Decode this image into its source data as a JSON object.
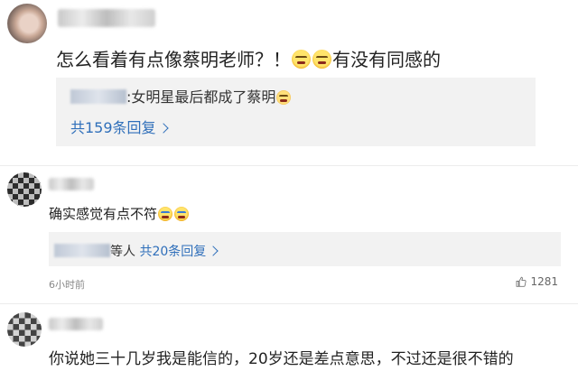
{
  "comments": [
    {
      "text_before": "怎么看着有点像蔡明老师？！",
      "text_after": "有没有同感的",
      "reply_preview_text": ":女明星最后都成了蔡明",
      "reply_count_label": "共159条回复"
    },
    {
      "text": "确实感觉有点不符",
      "reply_suffix": "等人",
      "reply_count_label": "共20条回复",
      "time": "6小时前",
      "likes": "1281"
    },
    {
      "text": "你说她三十几岁我是能信的，20岁还是差点意思，不过还是很不错的"
    }
  ],
  "icons": {
    "emoji_1": "grin-emoji-icon",
    "emoji_2": "cat-emoji-icon",
    "emoji_3": "laugh-cry-emoji-icon",
    "like": "thumbs-up-icon",
    "chevron": "chevron-right-icon"
  },
  "colors": {
    "link_blue": "#2f6fba",
    "reply_bg": "#f2f2f2",
    "meta_gray": "#888888"
  }
}
